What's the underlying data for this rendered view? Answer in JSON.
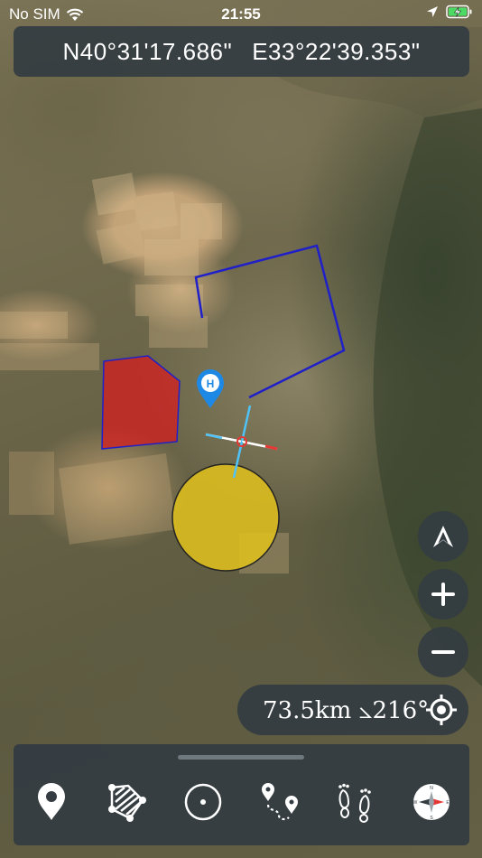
{
  "status_bar": {
    "carrier": "No SIM",
    "time": "21:55"
  },
  "coordinates": {
    "latitude": "N40°31'17.686\"",
    "longitude": "E33°22'39.353\""
  },
  "map": {
    "type": "satellite",
    "shapes": {
      "polygon_color": "#d61f1f",
      "polyline_color": "#2020c8",
      "circle_color": "#e3c21c",
      "marker_color": "#1e88e5"
    }
  },
  "map_controls": {
    "compass_mode": "navigation-arrow-icon",
    "zoom_in": "plus-icon",
    "zoom_out": "minus-icon"
  },
  "distance_readout": {
    "text": "73.5km ⦣216°"
  },
  "toolbar": {
    "items": [
      {
        "name": "marker-tool",
        "icon": "map-pin-icon"
      },
      {
        "name": "polygon-tool",
        "icon": "polygon-icon"
      },
      {
        "name": "circle-tool",
        "icon": "circle-icon"
      },
      {
        "name": "route-tool",
        "icon": "route-icon"
      },
      {
        "name": "track-tool",
        "icon": "footprints-icon"
      },
      {
        "name": "compass-tool",
        "icon": "compass-icon"
      }
    ]
  }
}
